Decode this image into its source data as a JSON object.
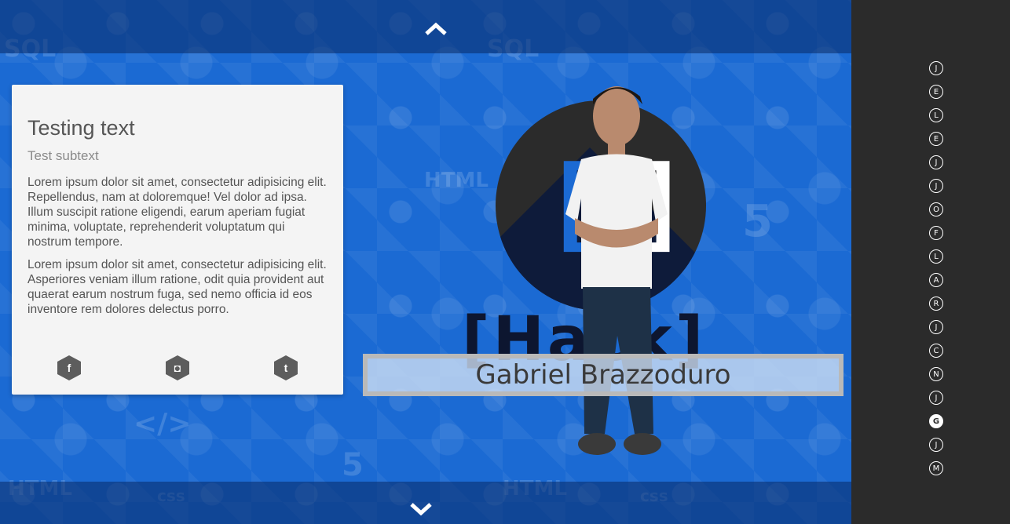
{
  "card": {
    "title": "Testing text",
    "subtitle": "Test subtext",
    "paragraphs": [
      "Lorem ipsum dolor sit amet, consectetur adipisicing elit. Repellendus, nam at doloremque! Vel dolor ad ipsa. Illum suscipit ratione eligendi, earum aperiam fugiat minima, voluptate, reprehenderit voluptatum qui nostrum tempore.",
      "Lorem ipsum dolor sit amet, consectetur adipisicing elit. Asperiores veniam illum ratione, odit quia provident aut quaerat earum nostrum fuga, sed nemo officia id eos inventore rem dolores delectus porro."
    ],
    "socials": [
      {
        "name": "facebook-icon",
        "glyph": "f"
      },
      {
        "name": "instagram-icon",
        "glyph": "◘"
      },
      {
        "name": "twitter-icon",
        "glyph": "t"
      }
    ]
  },
  "hero": {
    "name": "Gabriel Brazzoduro",
    "logo_word": "Hack"
  },
  "sidebar": {
    "dots": [
      "J",
      "E",
      "L",
      "E",
      "J",
      "J",
      "O",
      "F",
      "L",
      "A",
      "R",
      "J",
      "C",
      "N",
      "J",
      "G",
      "J",
      "M"
    ],
    "active_index": 15
  },
  "colors": {
    "background": "#1b6ad3",
    "sidebar": "#2b2b2b",
    "card": "#f4f4f4"
  }
}
